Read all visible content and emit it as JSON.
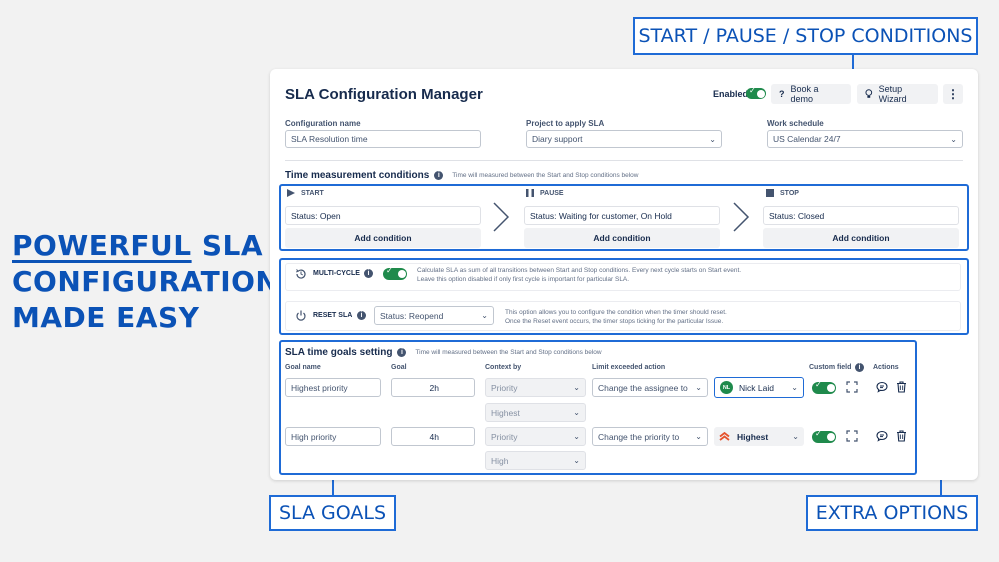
{
  "headline": {
    "line1_emph": "POWERFUL",
    "line1_rest": " SLA",
    "line2": "CONFIGURATION",
    "line3": "MADE EASY"
  },
  "callouts": {
    "start_pause_stop": "START / PAUSE / STOP CONDITIONS",
    "sla_goals": "SLA GOALS",
    "extra_options": "EXTRA OPTIONS"
  },
  "colors": {
    "accent": "#1f6bd6",
    "headline": "#0b52b6",
    "toggle_on": "#1f8a4c",
    "priority_high": "#e5532d"
  },
  "header": {
    "title": "SLA Configuration Manager",
    "enabled_label": "Enabled",
    "enabled": true,
    "book_demo": "Book a demo",
    "setup_wizard": "Setup Wizard"
  },
  "config": {
    "name_label": "Configuration name",
    "name_value": "SLA Resolution time",
    "project_label": "Project to apply SLA",
    "project_value": "Diary support",
    "schedule_label": "Work schedule",
    "schedule_value": "US Calendar 24/7"
  },
  "time_conditions": {
    "title": "Time measurement conditions",
    "hint": "Time will measured between the Start and Stop conditions below",
    "start": {
      "label": "START",
      "value": "Status: Open",
      "button": "Add condition"
    },
    "pause": {
      "label": "PAUSE",
      "value": "Status: Waiting for customer, On Hold",
      "button": "Add condition"
    },
    "stop": {
      "label": "STOP",
      "value": "Status: Closed",
      "button": "Add condition"
    }
  },
  "extra": {
    "multi_cycle": {
      "label": "MULTI-CYCLE",
      "enabled": true,
      "desc1": "Calculate SLA as sum of all transitions between Start and Stop conditions. Every next cycle starts on Start event.",
      "desc2": "Leave this option disabled if only first cycle is important for particular SLA."
    },
    "reset": {
      "label": "RESET SLA",
      "value": "Status: Reopend",
      "desc1": "This option allows you to configure the condition when the timer should reset.",
      "desc2": "Once the Reset event occurs, the timer stops ticking for the particular Issue."
    }
  },
  "goals": {
    "title": "SLA time goals setting",
    "hint": "Time will measured between the Start and Stop conditions below",
    "columns": [
      "Goal name",
      "Goal",
      "Context by",
      "Limit exceeded action",
      "Custom field",
      "Actions"
    ],
    "rows": [
      {
        "name": "Highest priority",
        "goal": "2h",
        "context": "Priority",
        "context_value": "Highest",
        "action": "Change the assignee to",
        "target": "Nick Laid",
        "target_initials": "NL",
        "custom_field": true
      },
      {
        "name": "High priority",
        "goal": "4h",
        "context": "Priority",
        "context_value": "High",
        "action": "Change the priority to",
        "target": "Highest",
        "custom_field": true
      }
    ]
  }
}
